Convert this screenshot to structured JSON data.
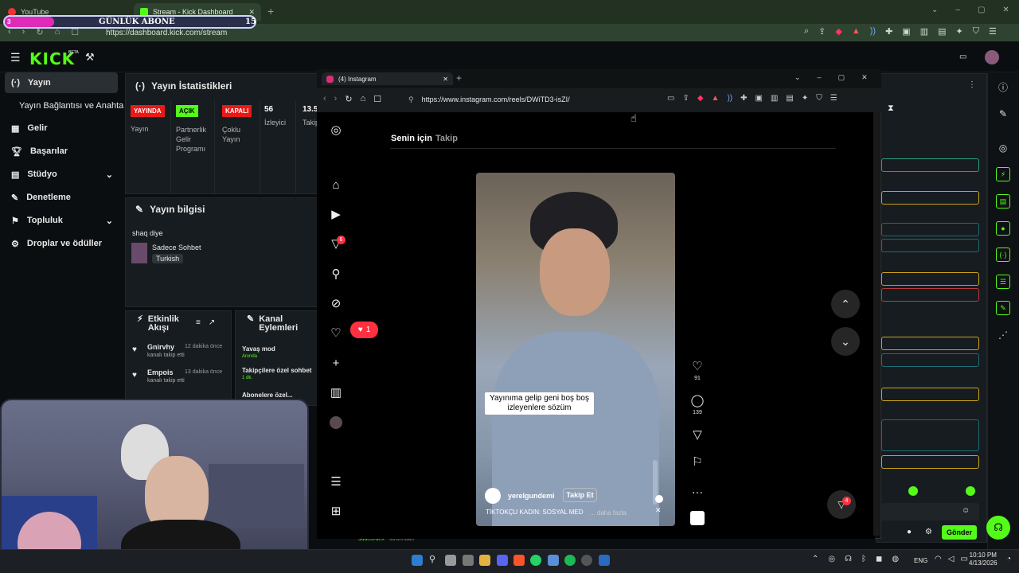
{
  "browser": {
    "tabs": [
      {
        "label": "YouTube",
        "active": false
      },
      {
        "label": "Stream - Kick Dashboard",
        "active": true
      }
    ],
    "new_tab_symbol": "+",
    "url": "https://dashboard.kick.com/stream"
  },
  "overlay": {
    "subscriber_goal_label": "GÜNLÜK ABONE",
    "current": "3",
    "goal": "15"
  },
  "kick": {
    "logo": "KICK",
    "logo_tag": "BETA",
    "nav": [
      {
        "label": "Yayın",
        "icon": "broadcast-icon",
        "selected": true
      },
      {
        "label": "Yayın Bağlantısı ve Anahtarı",
        "icon": "",
        "selected": false
      },
      {
        "label": "Gelir",
        "icon": "revenue-icon",
        "selected": false
      },
      {
        "label": "Başarılar",
        "icon": "trophy-icon",
        "selected": false
      },
      {
        "label": "Stüdyo",
        "icon": "studio-icon",
        "selected": false,
        "expandable": true
      },
      {
        "label": "Denetleme",
        "icon": "moderation-icon",
        "selected": false
      },
      {
        "label": "Topluluk",
        "icon": "community-icon",
        "selected": false,
        "expandable": true
      },
      {
        "label": "Droplar ve ödüller",
        "icon": "drops-icon",
        "selected": false
      }
    ],
    "stats_title": "Yayın İstatistikleri",
    "stats": [
      {
        "badge": "YAYINDA",
        "badge_color": "#e91916",
        "label": "Yayın"
      },
      {
        "badge": "AÇIK",
        "badge_color": "#53fc18",
        "label": "Partnerlik Gelir Programı"
      },
      {
        "badge": "KAPALI",
        "badge_color": "#e91916",
        "label": "Çoklu Yayın"
      },
      {
        "badge": "56",
        "badge_color": "",
        "label": "İzleyici"
      },
      {
        "badge": "13.5",
        "badge_color": "",
        "label": "Takip"
      }
    ],
    "info_title": "Yayın bilgisi",
    "stream_title": "shaq diye",
    "category": "Sadece Sohbet",
    "language_tag": "Turkish",
    "activity_title": "Etkinlik Akışı",
    "activity": [
      {
        "user": "Gnirvhy",
        "time": "12 dakika önce",
        "action": "kanalı takip etti"
      },
      {
        "user": "Empois",
        "time": "13 dakika önce",
        "action": "kanalı takip etti"
      }
    ],
    "channel_actions_title": "Kanal Eylemleri",
    "channel_actions": [
      {
        "label": "Yavaş mod",
        "sub": "Anında"
      },
      {
        "label": "Takipçilere özel sohbet",
        "sub": "1 dk."
      },
      {
        "label": "Abonelere özel...",
        "sub": ""
      }
    ],
    "chat_footer_user": "sudeordek",
    "chat_footer_text": "tarafından",
    "send_label": "Gönder"
  },
  "instagram": {
    "window_title": "(4) Instagram",
    "url": "https://www.instagram.com/reels/DWiTD3-isZI/",
    "tabs": [
      {
        "label": "Senin için",
        "active": true
      },
      {
        "label": "Takip",
        "active": false
      }
    ],
    "notification_count": "6",
    "likes_popup_count": "1",
    "caption": "Yayınıma gelip geni boş boş izleyenlere sözüm",
    "username": "yerelgundemi",
    "follow_label": "Takip Et",
    "description": "TİKTOKÇU KADIN: SOSYAL MED",
    "more_label": "... daha fazla",
    "like_count": "91",
    "comment_count": "139",
    "dm_badge": "4"
  },
  "taskbar": {
    "language": "ENG",
    "time": "10:10 PM",
    "date": "4/13/2026"
  },
  "colors": {
    "kick_green": "#53fc18",
    "live_red": "#e91916",
    "browser_green": "#2f4430",
    "overlay_pink": "#e02ab8"
  }
}
